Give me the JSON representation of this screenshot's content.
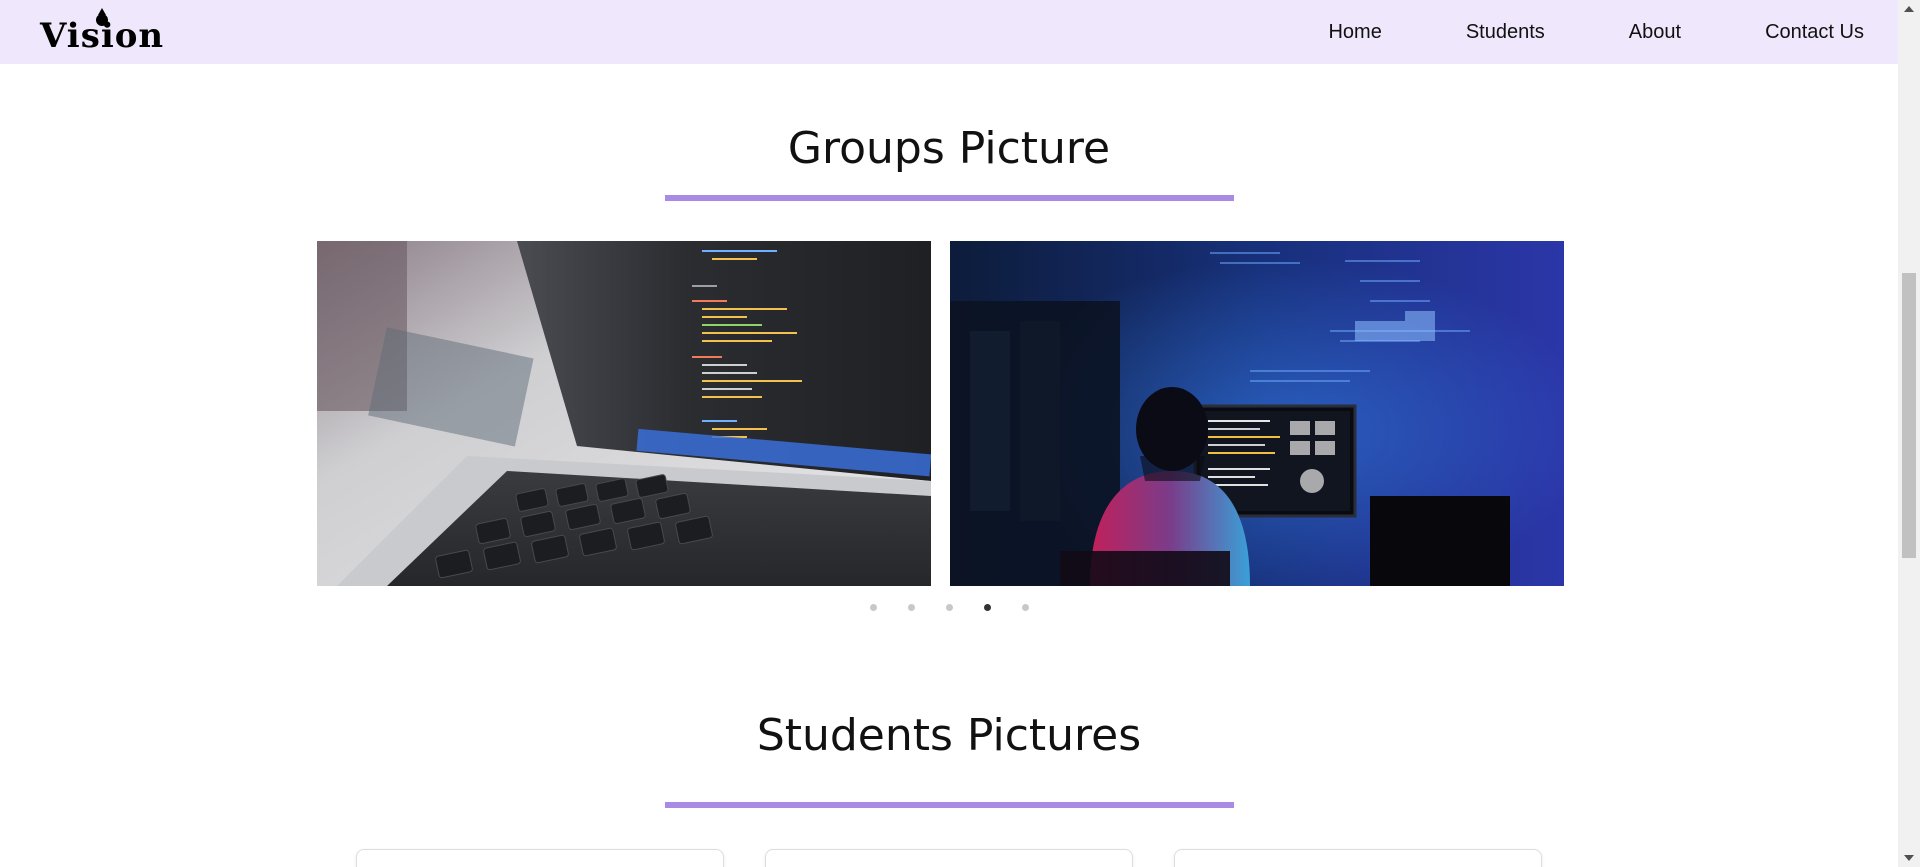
{
  "navbar": {
    "logo_text": "Vision",
    "links": [
      "Home",
      "Students",
      "About",
      "Contact Us"
    ]
  },
  "groups_section": {
    "title": "Groups Picture"
  },
  "carousel": {
    "slides": [
      {
        "image": "laptop-code-photo"
      },
      {
        "image": "programmer-at-monitor-photo"
      }
    ],
    "dot_count": 5,
    "active_dot": 4
  },
  "students_section": {
    "title": "Students Pictures"
  },
  "colors": {
    "navbar_bg": "#efe7fb",
    "accent_underline": "#a98be6",
    "active_dot": "#333333",
    "inactive_dot": "#c8c8c8"
  }
}
